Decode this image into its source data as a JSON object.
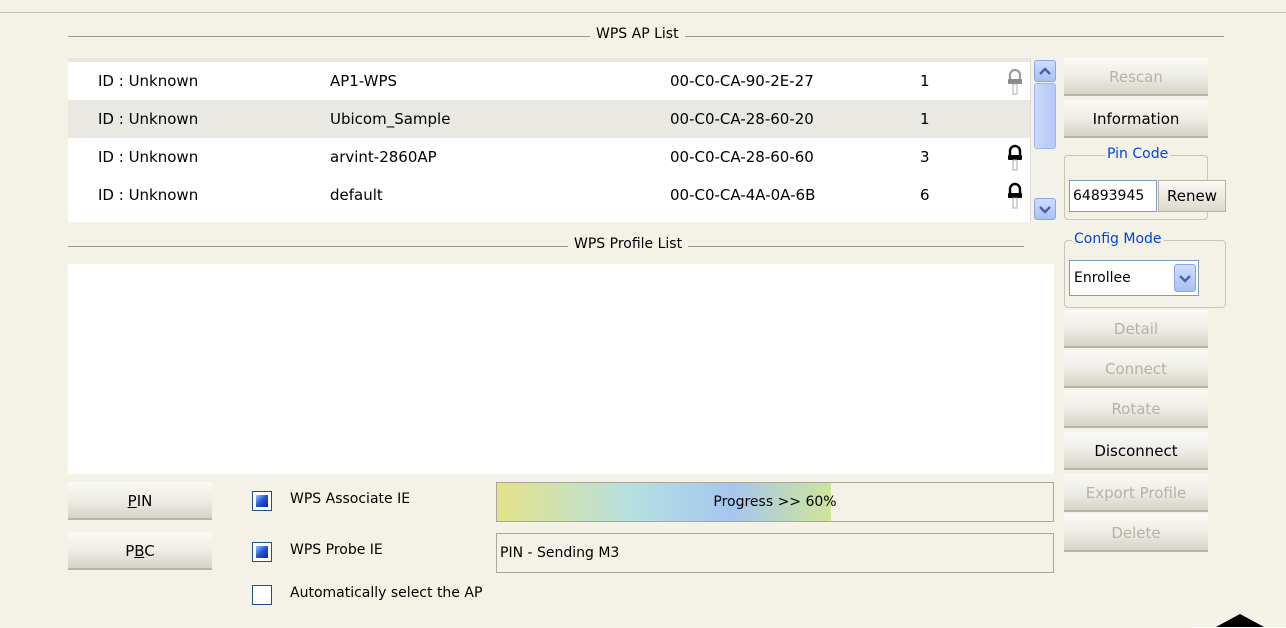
{
  "ap_list": {
    "title": "WPS AP List",
    "rows": [
      {
        "id": "ID : Unknown",
        "ssid": "AP1-WPS",
        "mac": "00-C0-CA-90-2E-27",
        "channel": "1",
        "icon": "key-lock-icon"
      },
      {
        "id": "ID : Unknown",
        "ssid": "Ubicom_Sample",
        "mac": "00-C0-CA-28-60-20",
        "channel": "1",
        "icon": "none"
      },
      {
        "id": "ID : Unknown",
        "ssid": "arvint-2860AP",
        "mac": "00-C0-CA-28-60-60",
        "channel": "3",
        "icon": "key-lock-icon"
      },
      {
        "id": "ID : Unknown",
        "ssid": "default",
        "mac": "00-C0-CA-4A-0A-6B",
        "channel": "6",
        "icon": "key-lock-icon"
      }
    ]
  },
  "profile_list": {
    "title": "WPS Profile List"
  },
  "side": {
    "rescan": "Rescan",
    "information": "Information",
    "pin_code_legend": "Pin Code",
    "pin_code_value": "64893945",
    "renew": "Renew",
    "config_mode_legend": "Config Mode",
    "config_mode_value": "Enrollee",
    "detail": "Detail",
    "connect": "Connect",
    "rotate": "Rotate",
    "disconnect": "Disconnect",
    "export_profile": "Export Profile",
    "delete": "Delete"
  },
  "bottom": {
    "pin_pre": "",
    "pin_ul": "P",
    "pin_post": "IN",
    "pbc_pre": "P",
    "pbc_ul": "B",
    "pbc_post": "C",
    "wps_associate_ie": "WPS Associate IE",
    "wps_probe_ie": "WPS Probe IE",
    "auto_select": "Automatically select the AP",
    "progress_text": "Progress >> 60%",
    "progress_fraction": 0.6,
    "status_text": "PIN - Sending M3",
    "associate_checked": true,
    "probe_checked": true,
    "auto_checked": false
  },
  "colors": {
    "background": "#f4f1e6",
    "legend_blue": "#0046d5",
    "disabled_text": "#b5b3a8"
  }
}
